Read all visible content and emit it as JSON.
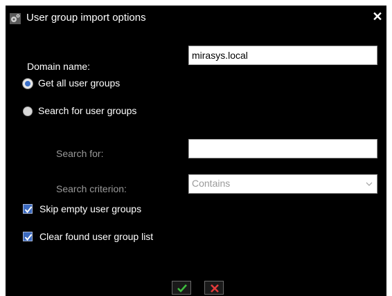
{
  "dialog": {
    "title": "User group import options",
    "title_icon": "gears-icon",
    "close_icon": "close-icon",
    "close_label": "✕"
  },
  "form": {
    "domain_label": "Domain name:",
    "domain_value": "mirasys.local",
    "radio_get_all": "Get all user groups",
    "radio_search": "Search for user groups",
    "search_for_label": "Search for:",
    "search_for_value": "",
    "criterion_label": "Search criterion:",
    "criterion_value": "Contains",
    "skip_empty_label": "Skip empty user groups",
    "clear_found_label": "Clear found user group list"
  },
  "state": {
    "selected_radio": "get_all",
    "skip_empty_checked": true,
    "clear_found_checked": true
  },
  "buttons": {
    "ok_icon": "checkmark-icon",
    "cancel_icon": "x-icon"
  },
  "colors": {
    "background": "#000000",
    "ok_green": "#3fbf3f",
    "cancel_red": "#e23a3a",
    "accent_blue": "#3a6fc8"
  }
}
